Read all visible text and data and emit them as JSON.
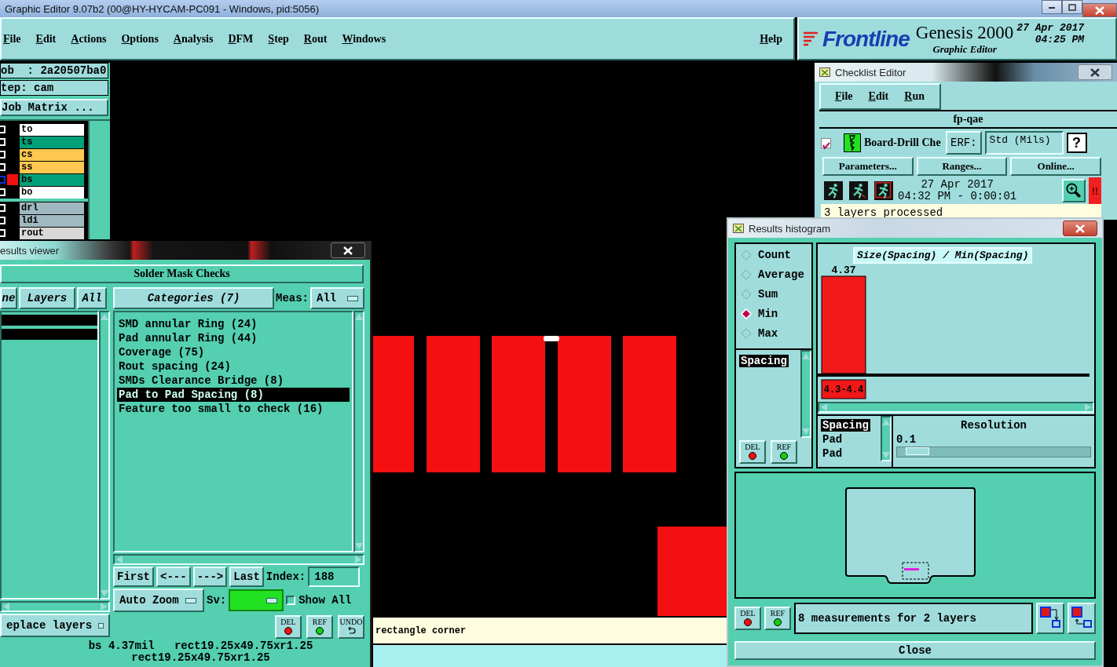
{
  "window": {
    "title": "Graphic Editor 9.07b2 (00@HY-HYCAM-PC091 - Windows, pid:5056)"
  },
  "menu": [
    "File",
    "Edit",
    "Actions",
    "Options",
    "Analysis",
    "DFM",
    "Step",
    "Rout",
    "Windows"
  ],
  "help": "Help",
  "brand": {
    "logo": "Frontline",
    "product": "Genesis 2000",
    "subtitle": "Graphic Editor",
    "date": "27 Apr 2017",
    "time": "04:25 PM"
  },
  "job_panel": {
    "job": "ob  : 2a20507ba0",
    "step": "tep: cam",
    "matrix_button": "Job Matrix ..."
  },
  "layers": [
    {
      "name": "to",
      "color": "#ffffff",
      "displayed": false,
      "work": false
    },
    {
      "name": "ts",
      "color": "#00a078",
      "displayed": false,
      "work": false
    },
    {
      "name": "cs",
      "color": "#ffc850",
      "displayed": false,
      "work": false
    },
    {
      "name": "ss",
      "color": "#ffc850",
      "displayed": false,
      "work": false
    },
    {
      "name": "bs",
      "color": "#00a078",
      "displayed": false,
      "work": true
    },
    {
      "name": "bo",
      "color": "#ffffff",
      "displayed": false,
      "work": false
    },
    {
      "name": "drl",
      "color": "#a0b8c0",
      "displayed": false,
      "work": false
    },
    {
      "name": "ldi",
      "color": "#a0b8c0",
      "displayed": false,
      "work": false
    },
    {
      "name": "rout",
      "color": "#d8d8d8",
      "displayed": false,
      "work": false
    }
  ],
  "canvas": {
    "prompt": "rectangle corner"
  },
  "results_viewer": {
    "title": "esults viewer",
    "header": "Solder Mask Checks",
    "left_tabs": [
      "ne",
      "Layers",
      "All"
    ],
    "layer_rows": [
      {
        "selected": true
      },
      {
        "selected": true
      }
    ],
    "categories_button": "Categories (7)",
    "meas_label": "Meas:",
    "meas_value": "All",
    "categories": [
      {
        "label": "SMD annular Ring (24)",
        "selected": false
      },
      {
        "label": "Pad annular Ring (44)",
        "selected": false
      },
      {
        "label": "Coverage (75)",
        "selected": false
      },
      {
        "label": "Rout spacing (24)",
        "selected": false
      },
      {
        "label": "SMDs Clearance Bridge (8)",
        "selected": false
      },
      {
        "label": "Pad to Pad Spacing (8)",
        "selected": true
      },
      {
        "label": "Feature too small to check (16)",
        "selected": false
      }
    ],
    "nav_buttons": [
      "First",
      "<---",
      "--->",
      "Last"
    ],
    "index_label": "Index:",
    "index_value": "188",
    "zoom_mode": "Auto Zoom",
    "sv_label": "Sv:",
    "show_all": {
      "label": "Show All",
      "checked": false
    },
    "layers_mode": "eplace layers",
    "tool_buttons": [
      {
        "label": "DEL",
        "kind": "delete"
      },
      {
        "label": "REF",
        "kind": "refresh"
      },
      {
        "label": "UNDO",
        "kind": "undo"
      }
    ],
    "status_lines": [
      "bs 4.37mil   rect19.25x49.75xr1.25",
      "rect19.25x49.75xr1.25"
    ]
  },
  "checklist_editor": {
    "title": "Checklist Editor",
    "menu": [
      "File",
      "Edit",
      "Run"
    ],
    "checklist_name": "fp-qae",
    "action": {
      "checked": true,
      "name": "Board-Drill Che",
      "erf_button": "ERF:",
      "erf_value": "Std (Mils)",
      "help_button": "?"
    },
    "buttons": [
      "Parameters...",
      "Ranges...",
      "Online..."
    ],
    "run_date": "27 Apr 2017",
    "run_time": "04:32 PM - 0:00:01",
    "alert": "!!",
    "message": "3 layers processed"
  },
  "histogram": {
    "title": "Results histogram",
    "modes": [
      {
        "label": "Count",
        "selected": false
      },
      {
        "label": "Average",
        "selected": false
      },
      {
        "label": "Sum",
        "selected": false
      },
      {
        "label": "Min",
        "selected": true
      },
      {
        "label": "Max",
        "selected": false
      }
    ],
    "measures": [
      {
        "label": "Spacing",
        "selected": true
      }
    ],
    "tool_buttons": [
      {
        "label": "DEL",
        "kind": "delete"
      },
      {
        "label": "REF",
        "kind": "refresh"
      }
    ],
    "chart_title": "Size(Spacing) / Min(Spacing)",
    "bins": [
      {
        "value_label": "4.37",
        "range_label": "4.3-4.4"
      }
    ],
    "layer_list": [
      {
        "label": "Spacing",
        "selected": true
      },
      {
        "label": "Pad",
        "selected": false
      },
      {
        "label": "Pad",
        "selected": false
      }
    ],
    "resolution_label": "Resolution",
    "resolution_value": "0.1",
    "resolution": {
      "level": 0.05
    },
    "status": "8 measurements for 2 layers",
    "bottom_tool_buttons": [
      {
        "label": "DEL",
        "kind": "delete"
      },
      {
        "label": "REF",
        "kind": "refresh"
      }
    ],
    "close_button": "Close"
  }
}
